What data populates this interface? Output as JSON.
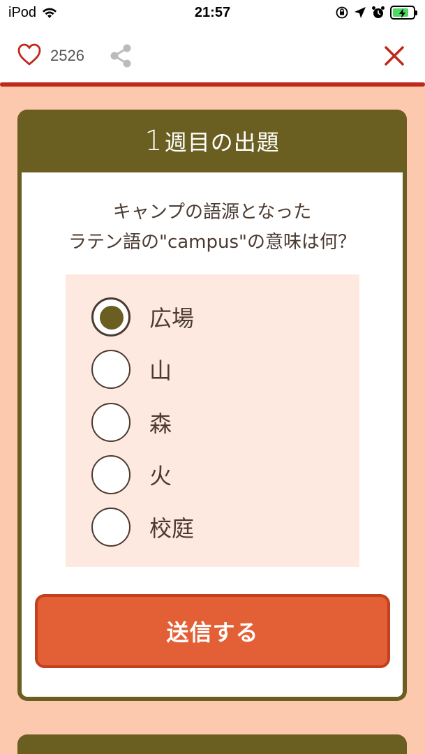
{
  "status_bar": {
    "carrier": "iPod",
    "time": "21:57"
  },
  "toolbar": {
    "like_count": "2526",
    "heart_icon": "heart-outline-icon",
    "share_icon": "share-icon",
    "close_icon": "close-icon"
  },
  "quiz": {
    "week_number": "1",
    "header_title": "週目の出題",
    "question_line1": "キャンプの語源となった",
    "question_line2": "ラテン語の\"campus\"の意味は何？",
    "options": [
      {
        "label": "広場",
        "selected": true
      },
      {
        "label": "山",
        "selected": false
      },
      {
        "label": "森",
        "selected": false
      },
      {
        "label": "火",
        "selected": false
      },
      {
        "label": "校庭",
        "selected": false
      }
    ],
    "submit_label": "送信する"
  },
  "colors": {
    "background": "#fcc9ae",
    "card_header": "#6b5e21",
    "accent_red": "#c0281c",
    "submit": "#e35f36",
    "options_bg": "#fde9e0"
  }
}
